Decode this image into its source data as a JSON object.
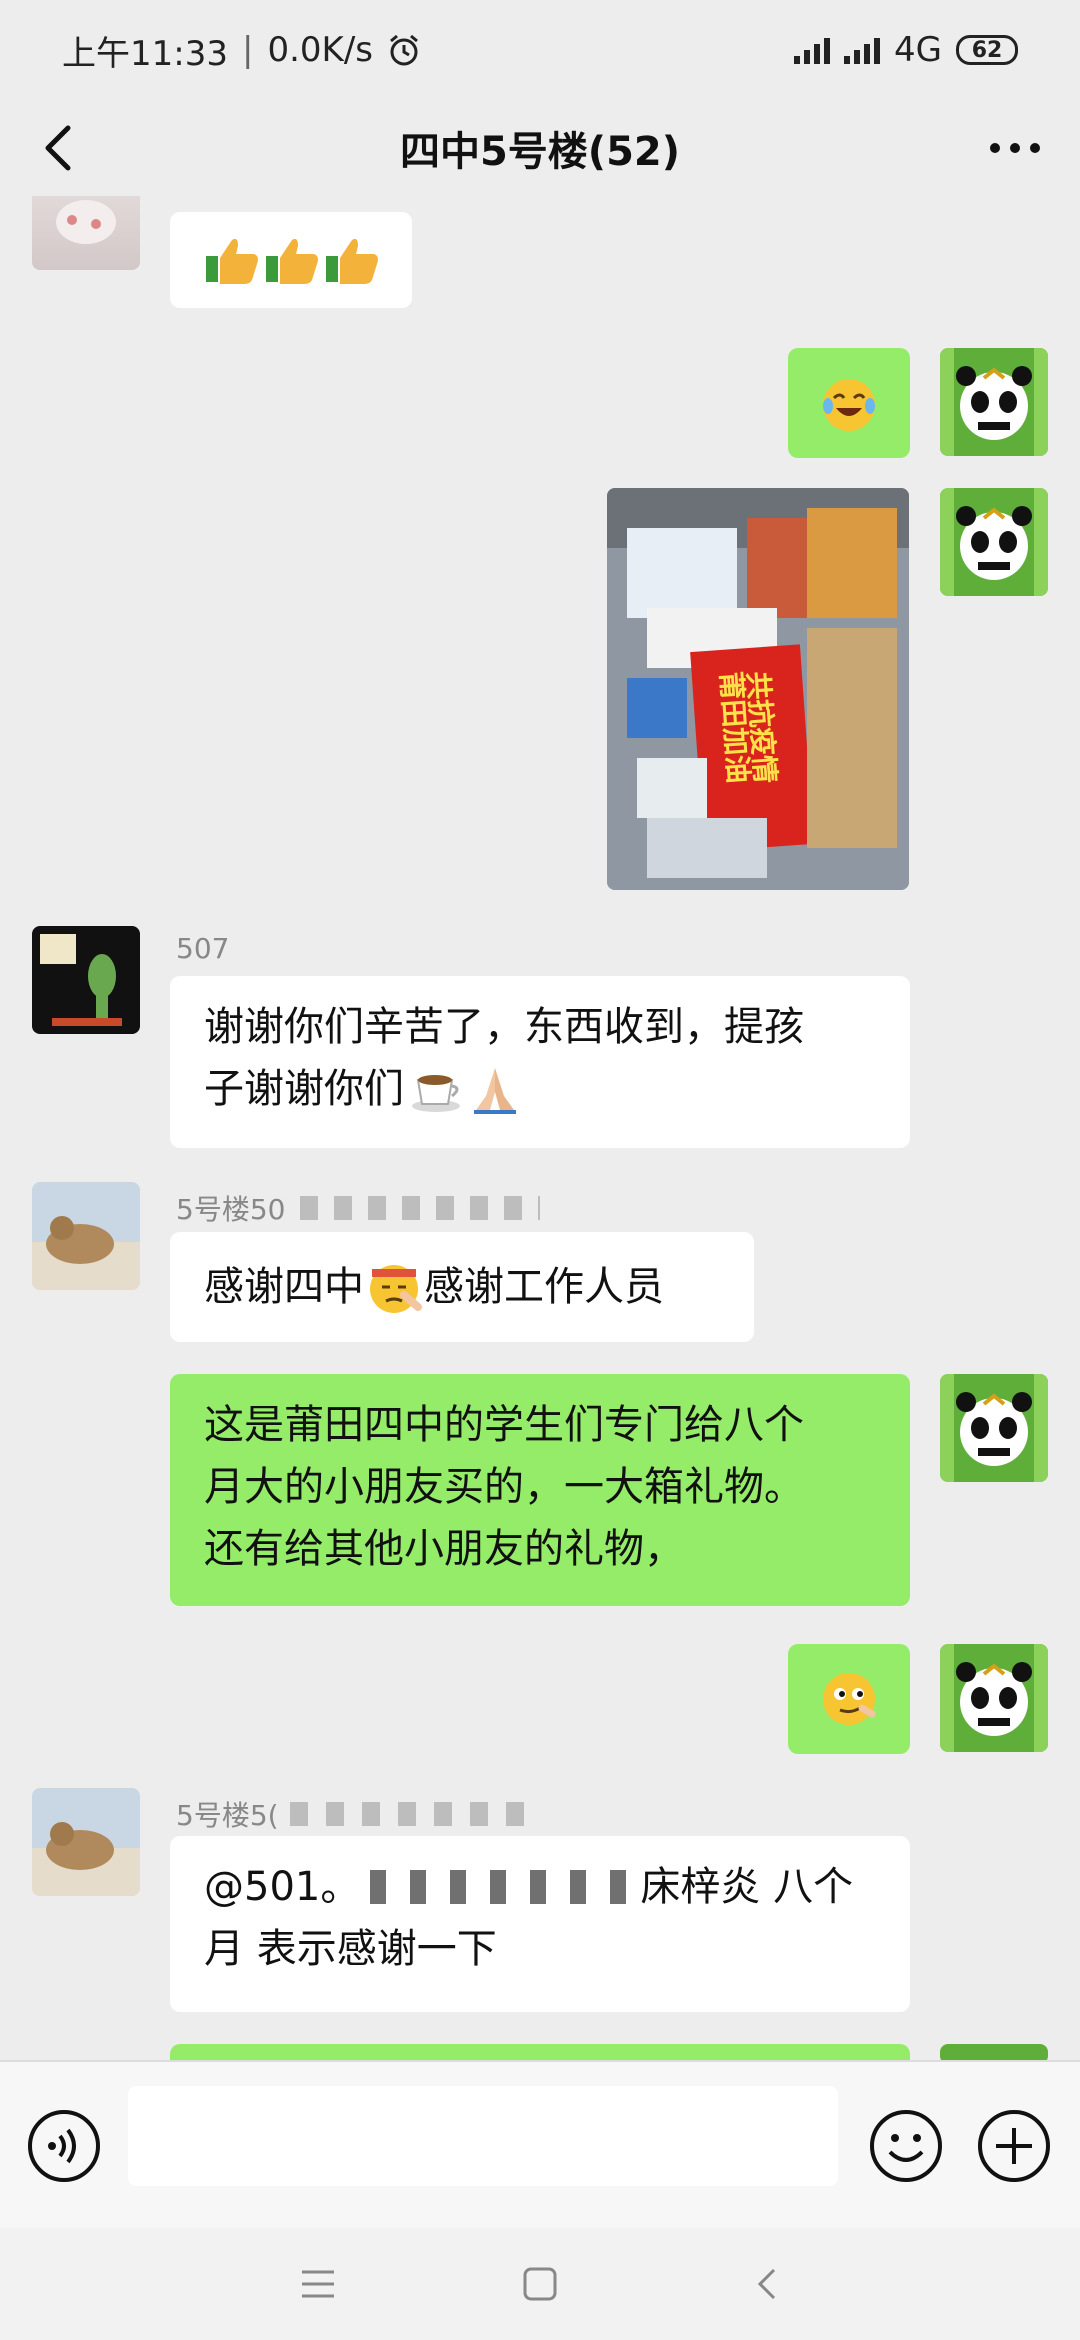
{
  "status_bar": {
    "time": "上午11:33",
    "speed": "0.0K/s",
    "network": "4G",
    "battery": "62"
  },
  "header": {
    "title": "四中5号楼(52)"
  },
  "messages": [
    {
      "side": "left",
      "type": "emoji",
      "icon": "thumbs-up-icon x3"
    },
    {
      "side": "right",
      "type": "emoji",
      "icon": "laughing-crying-icon"
    },
    {
      "side": "right",
      "type": "image",
      "poster_text": [
        "共抗疫情",
        "莆田加油"
      ]
    },
    {
      "side": "left",
      "sender": "507",
      "text_lines": [
        "谢谢你们辛苦了，东西收到，提孩",
        "子谢谢你们"
      ],
      "trailing_icons": [
        "coffee-icon",
        "praying-hands-icon"
      ]
    },
    {
      "side": "left",
      "sender": "5号楼50",
      "text_parts": [
        "感谢四中",
        "感谢工作人员"
      ],
      "inline_icon": "saluting-face-icon"
    },
    {
      "side": "right",
      "text_lines": [
        "这是莆田四中的学生们专门给八个",
        "月大的小朋友买的，一大箱礼物。",
        "还有给其他小朋友的礼物，"
      ]
    },
    {
      "side": "right",
      "type": "emoji",
      "icon": "smirk-face-icon"
    },
    {
      "side": "left",
      "sender": "5号楼5(",
      "text_lines": [
        "@501。",
        "床梓炎 八个",
        "月  表示感谢一下"
      ]
    }
  ],
  "colors": {
    "background": "#ededed",
    "bubble_green": "#95ec69",
    "bubble_white": "#ffffff"
  }
}
